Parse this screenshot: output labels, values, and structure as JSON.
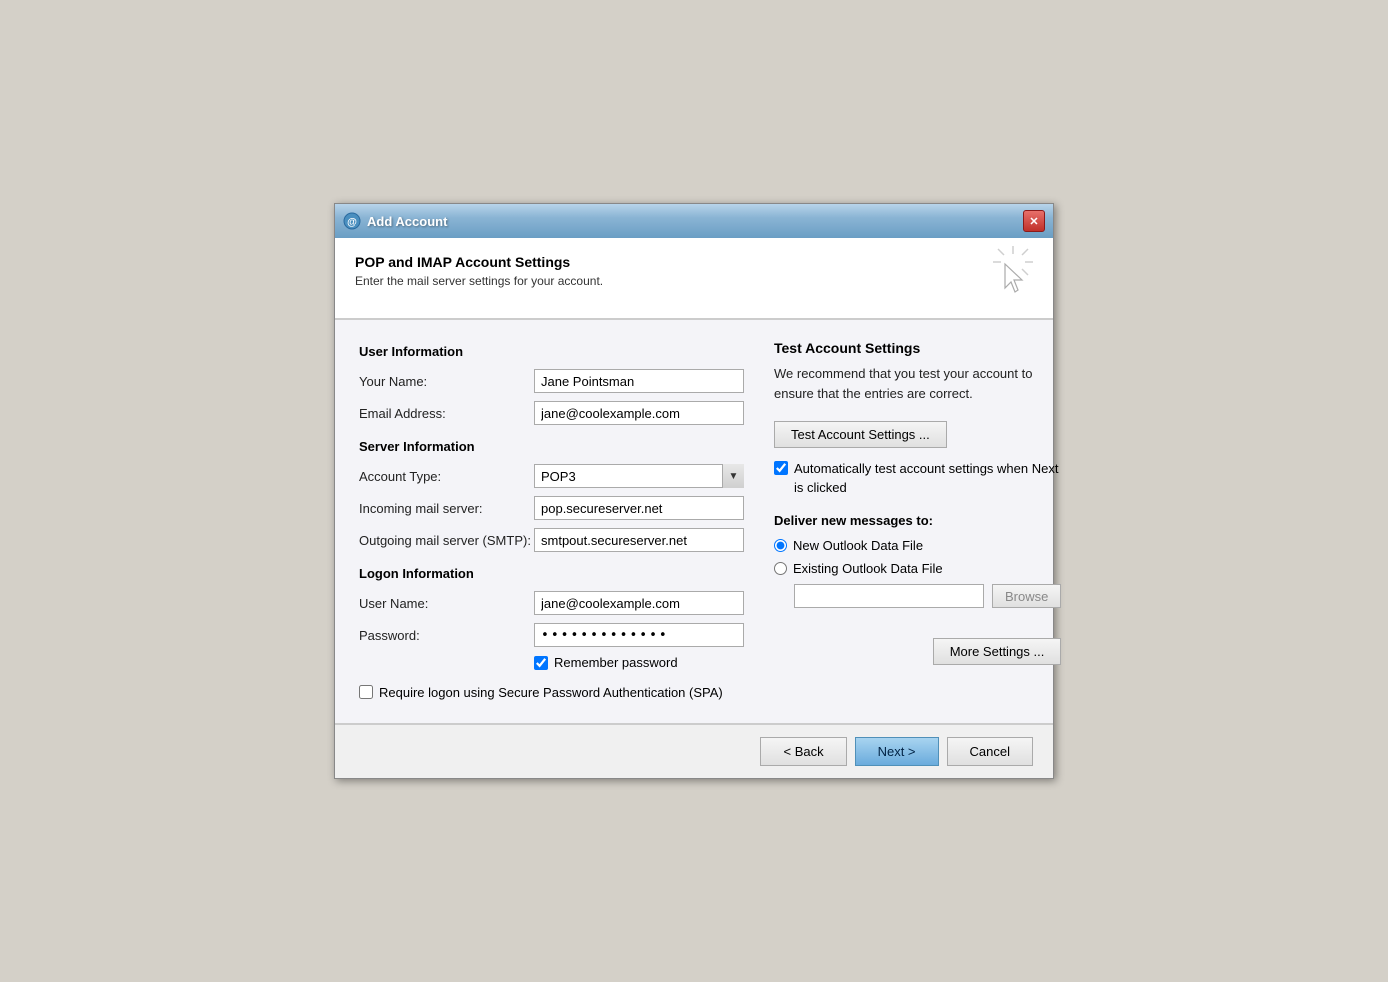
{
  "window": {
    "title": "Add Account",
    "close_label": "✕"
  },
  "header": {
    "title": "POP and IMAP Account Settings",
    "subtitle": "Enter the mail server settings for your account."
  },
  "left": {
    "user_info_title": "User Information",
    "your_name_label": "Your Name:",
    "your_name_value": "Jane Pointsman",
    "email_address_label": "Email Address:",
    "email_address_value": "jane@coolexample.com",
    "server_info_title": "Server Information",
    "account_type_label": "Account Type:",
    "account_type_value": "POP3",
    "incoming_mail_label": "Incoming mail server:",
    "incoming_mail_value": "pop.secureserver.net",
    "outgoing_mail_label": "Outgoing mail server (SMTP):",
    "outgoing_mail_value": "smtpout.secureserver.net",
    "logon_info_title": "Logon Information",
    "user_name_label": "User Name:",
    "user_name_value": "jane@coolexample.com",
    "password_label": "Password:",
    "password_value": "****************",
    "remember_password_label": "Remember password",
    "spa_label": "Require logon using Secure Password Authentication (SPA)"
  },
  "right": {
    "test_section_title": "Test Account Settings",
    "test_desc": "We recommend that you test your account to ensure that the entries are correct.",
    "test_btn_label": "Test Account Settings ...",
    "auto_test_label": "Automatically test account settings when Next is clicked",
    "deliver_title": "Deliver new messages to:",
    "new_file_label": "New Outlook Data File",
    "existing_file_label": "Existing Outlook Data File",
    "browse_btn_label": "Browse",
    "more_settings_label": "More Settings ..."
  },
  "footer": {
    "back_label": "< Back",
    "next_label": "Next >",
    "cancel_label": "Cancel"
  }
}
